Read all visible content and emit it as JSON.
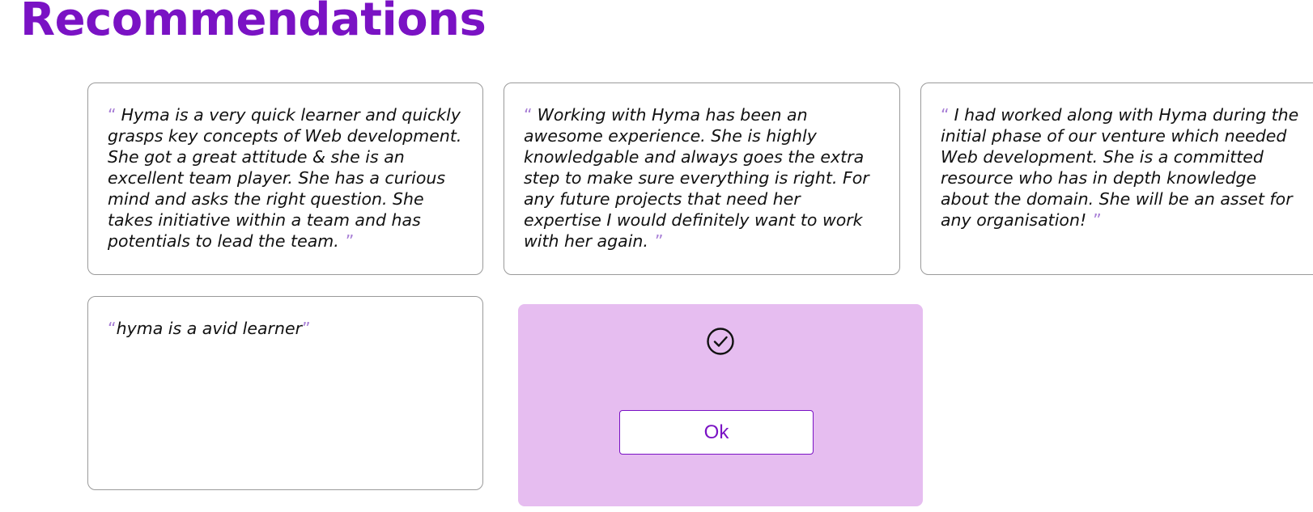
{
  "page": {
    "title": "Recommendations"
  },
  "recommendations": [
    {
      "open_quote": "“",
      "text": "Hyma is a very quick learner and quickly grasps key concepts of Web development. She got a great attitude & she is an excellent team player. She has a curious mind and asks the right question. She takes initiative within a team and has potentials to lead the team.",
      "close_quote": "”"
    },
    {
      "open_quote": "“",
      "text": "Working with Hyma has been an awesome experience. She is highly knowledgable and always goes the extra step to make sure everything is right. For any future projects that need her expertise I would definitely want to work with her again.",
      "close_quote": "”"
    },
    {
      "open_quote": "“",
      "text": "I had worked along with Hyma during the initial phase of our venture which needed Web development. She is a committed resource who has in depth knowledge about the domain. She will be an asset for any organisation!",
      "close_quote": "”"
    },
    {
      "open_quote": "“",
      "text": "hyma is a avid learner",
      "close_quote": "”"
    }
  ],
  "dialog": {
    "icon": "check-circle-icon",
    "ok_label": "Ok"
  },
  "colors": {
    "title": "#7a12c4",
    "quote_mark": "#a87fd6",
    "dialog_background": "#e6bdf0",
    "button_text": "#7a12c4"
  }
}
